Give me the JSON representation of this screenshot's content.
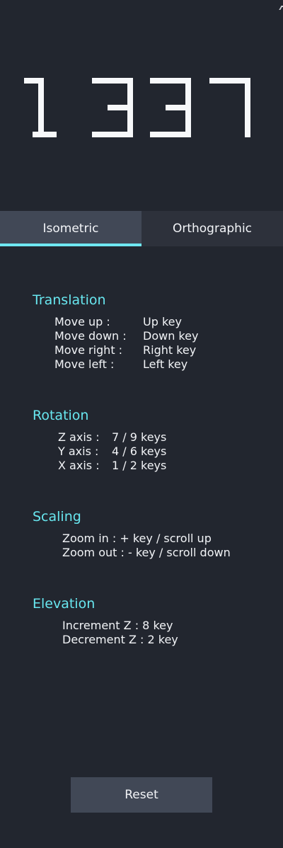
{
  "logo": {
    "text": "1337"
  },
  "tabs": [
    {
      "label": "Isometric",
      "active": true
    },
    {
      "label": "Orthographic",
      "active": false
    }
  ],
  "sections": {
    "translation": {
      "title": "Translation",
      "items": [
        {
          "action": "Move up :",
          "key": "Up key"
        },
        {
          "action": "Move down :",
          "key": "Down key"
        },
        {
          "action": "Move right :",
          "key": "Right key"
        },
        {
          "action": "Move left :",
          "key": "Left key"
        }
      ]
    },
    "rotation": {
      "title": "Rotation",
      "items": [
        {
          "action": "Z axis :",
          "key": "7 / 9 keys"
        },
        {
          "action": "Y axis :",
          "key": "4 / 6 keys"
        },
        {
          "action": "X axis :",
          "key": "1 / 2 keys"
        }
      ]
    },
    "scaling": {
      "title": "Scaling",
      "items": [
        "Zoom in : + key / scroll up",
        "Zoom out : - key / scroll down"
      ]
    },
    "elevation": {
      "title": "Elevation",
      "items": [
        "Increment Z : 8 key",
        "Decrement Z : 2 key"
      ]
    }
  },
  "footer": {
    "reset_label": "Reset"
  },
  "colors": {
    "background": "#22262f",
    "accent": "#6fe8f2",
    "tab_active": "#414856",
    "tab_inactive": "#2d313b"
  }
}
